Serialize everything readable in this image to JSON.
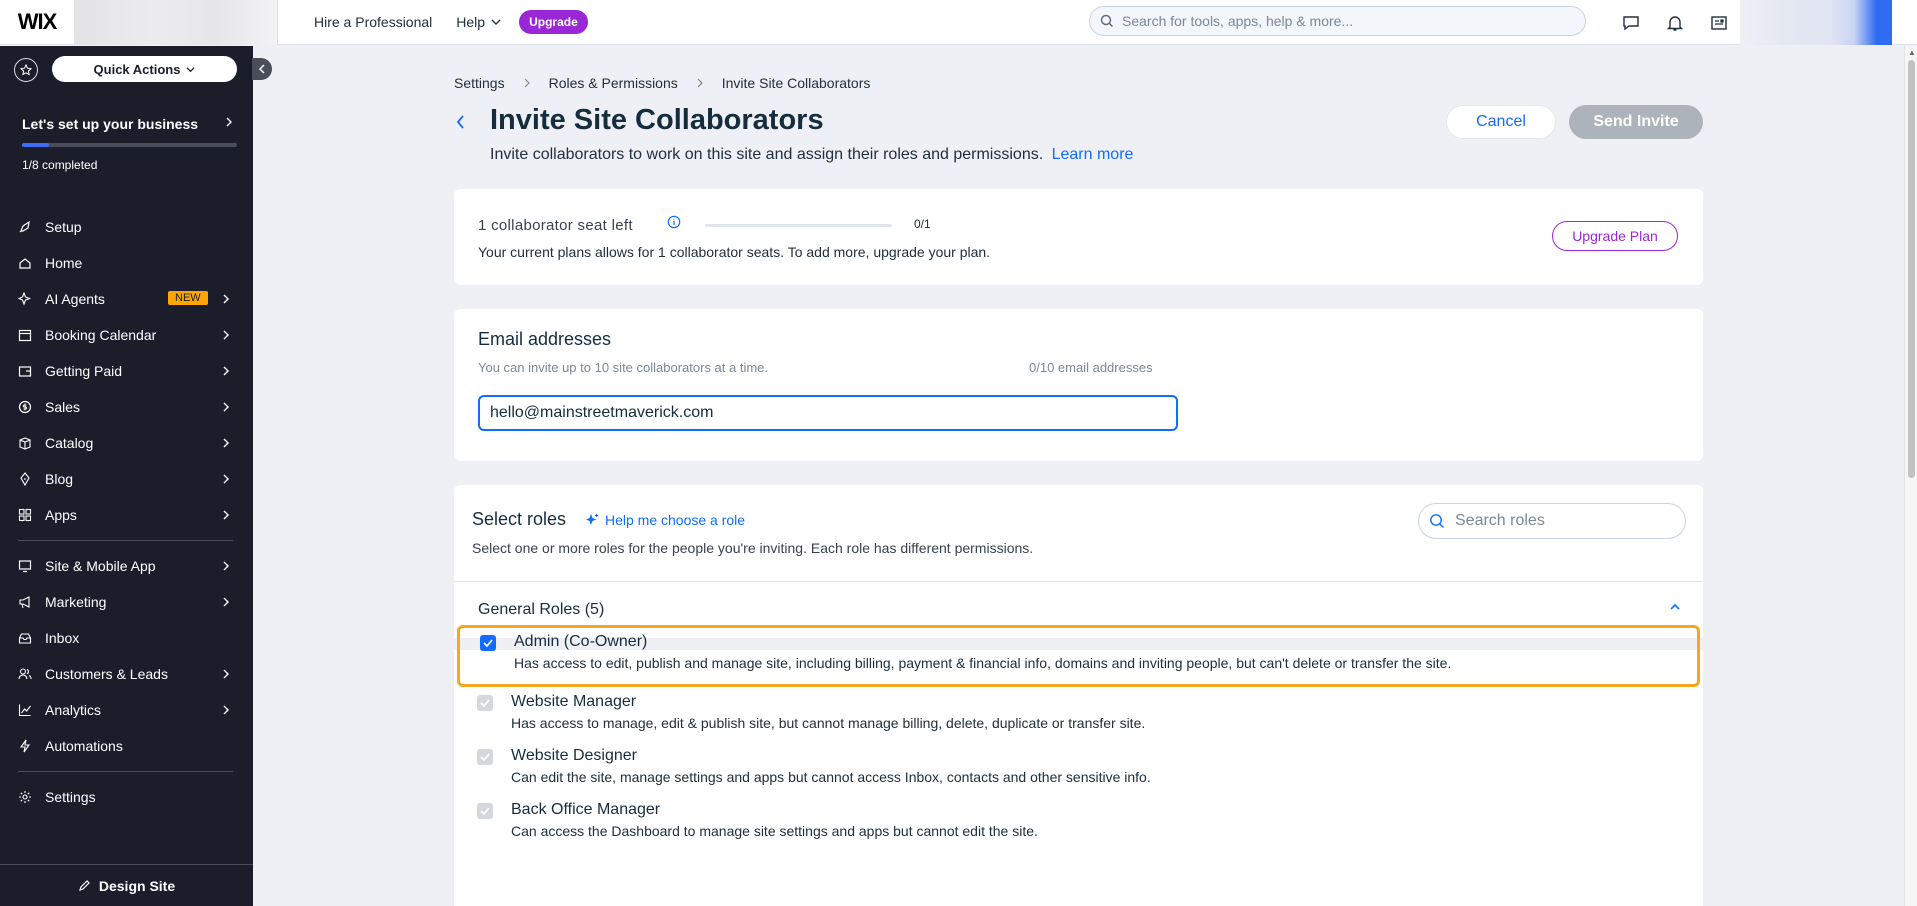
{
  "topbar": {
    "logo": "WIX",
    "hire_label": "Hire a Professional",
    "help_label": "Help",
    "upgrade_label": "Upgrade",
    "search_placeholder": "Search for tools, apps, help & more..."
  },
  "sidebar": {
    "quick_actions_label": "Quick Actions",
    "setup_title": "Let's set up your business",
    "progress_text": "1/8 completed",
    "progress_fraction": 0.125,
    "items": [
      {
        "label": "Setup",
        "icon": "rocket-icon"
      },
      {
        "label": "Home",
        "icon": "home-icon"
      },
      {
        "label": "AI Agents",
        "icon": "sparkle-icon",
        "badge": "NEW"
      },
      {
        "label": "Booking Calendar",
        "icon": "calendar-icon"
      },
      {
        "label": "Getting Paid",
        "icon": "wallet-icon"
      },
      {
        "label": "Sales",
        "icon": "dollar-icon"
      },
      {
        "label": "Catalog",
        "icon": "catalog-icon"
      },
      {
        "label": "Blog",
        "icon": "blog-icon"
      },
      {
        "label": "Apps",
        "icon": "apps-icon"
      },
      {
        "label": "Site & Mobile App",
        "icon": "site-icon"
      },
      {
        "label": "Marketing",
        "icon": "megaphone-icon"
      },
      {
        "label": "Inbox",
        "icon": "inbox-icon"
      },
      {
        "label": "Customers & Leads",
        "icon": "people-icon"
      },
      {
        "label": "Analytics",
        "icon": "chart-icon"
      },
      {
        "label": "Automations",
        "icon": "bolt-icon"
      },
      {
        "label": "Settings",
        "icon": "gear-icon"
      }
    ],
    "design_site_label": "Design Site"
  },
  "breadcrumb": [
    "Settings",
    "Roles & Permissions",
    "Invite Site Collaborators"
  ],
  "page": {
    "title": "Invite Site Collaborators",
    "subtitle": "Invite collaborators to work on this site and assign their roles and permissions.",
    "learn_more": "Learn more",
    "cancel_label": "Cancel",
    "send_label": "Send Invite"
  },
  "seats": {
    "label": "1 collaborator seat left",
    "count": "0/1",
    "description": "Your current plans allows for 1 collaborator seats. To add more, upgrade your plan.",
    "upgrade_plan_label": "Upgrade Plan"
  },
  "email": {
    "title": "Email addresses",
    "help": "You can invite up to 10 site collaborators at a time.",
    "count": "0/10 email addresses",
    "value": "hello@mainstreetmaverick.com"
  },
  "roles": {
    "title": "Select roles",
    "help_link": "Help me choose a role",
    "description": "Select one or more roles for the people you're inviting. Each role has different permissions.",
    "search_placeholder": "Search roles",
    "general_label": "General Roles (5)",
    "items": [
      {
        "name": "Admin (Co-Owner)",
        "desc": "Has access to edit, publish and manage site, including billing, payment & financial info, domains and inviting people, but can't delete or transfer the site.",
        "checked": true
      },
      {
        "name": "Website Manager",
        "desc": "Has access to manage, edit & publish site, but cannot manage billing, delete, duplicate or transfer site.",
        "checked": false
      },
      {
        "name": "Website Designer",
        "desc": "Can edit the site, manage settings and apps but cannot access Inbox, contacts and other sensitive info.",
        "checked": false
      },
      {
        "name": "Back Office Manager",
        "desc": "Can access the Dashboard to manage site settings and apps but cannot edit the site.",
        "checked": false
      }
    ]
  },
  "colors": {
    "accent": "#116dff",
    "upgrade": "#9a27d5",
    "sidebar_bg": "#1b1e2a",
    "highlight": "#f5a623"
  }
}
